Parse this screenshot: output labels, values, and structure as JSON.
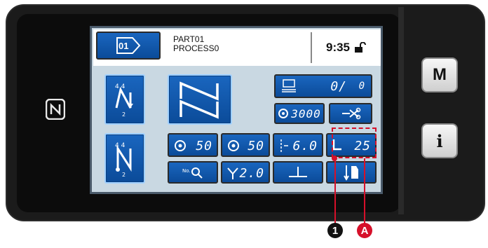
{
  "header": {
    "part_label": "PART01",
    "process_label": "PROCESS0",
    "time": "9:35",
    "pattern_no": "01"
  },
  "side_buttons": {
    "mode": "M",
    "info": "i"
  },
  "counter": {
    "value": "0/",
    "max": "0"
  },
  "bobbin": {
    "value": "3000"
  },
  "params": {
    "tension_left": "50",
    "tension_right": "50",
    "stitch_length": "6.0",
    "presser_height": "25",
    "alt_amount": "2.0"
  },
  "callouts": {
    "one": "1",
    "a": "A"
  },
  "colors": {
    "button_blue": "#0b4b99",
    "callout_red": "#d6102a",
    "screen_bg": "#c9d8e2"
  },
  "icons": [
    "nfc-icon",
    "pattern-arrow-icon",
    "lock-icon",
    "counter-icon",
    "bobbin-icon",
    "thread-trim-icon",
    "tension-left-icon",
    "tension-right-icon",
    "stitch-length-icon",
    "presser-foot-icon",
    "search-number-icon",
    "alt-icon",
    "needle-center-icon",
    "thread-guide-icon"
  ]
}
